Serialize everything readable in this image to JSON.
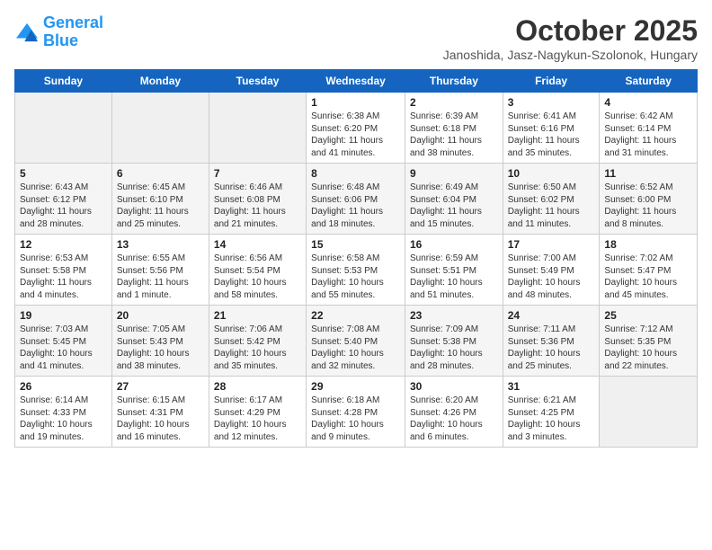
{
  "header": {
    "logo_line1": "General",
    "logo_line2": "Blue",
    "title": "October 2025",
    "subtitle": "Janoshida, Jasz-Nagykun-Szolonok, Hungary"
  },
  "days_of_week": [
    "Sunday",
    "Monday",
    "Tuesday",
    "Wednesday",
    "Thursday",
    "Friday",
    "Saturday"
  ],
  "weeks": [
    [
      {
        "num": "",
        "info": ""
      },
      {
        "num": "",
        "info": ""
      },
      {
        "num": "",
        "info": ""
      },
      {
        "num": "1",
        "info": "Sunrise: 6:38 AM\nSunset: 6:20 PM\nDaylight: 11 hours\nand 41 minutes."
      },
      {
        "num": "2",
        "info": "Sunrise: 6:39 AM\nSunset: 6:18 PM\nDaylight: 11 hours\nand 38 minutes."
      },
      {
        "num": "3",
        "info": "Sunrise: 6:41 AM\nSunset: 6:16 PM\nDaylight: 11 hours\nand 35 minutes."
      },
      {
        "num": "4",
        "info": "Sunrise: 6:42 AM\nSunset: 6:14 PM\nDaylight: 11 hours\nand 31 minutes."
      }
    ],
    [
      {
        "num": "5",
        "info": "Sunrise: 6:43 AM\nSunset: 6:12 PM\nDaylight: 11 hours\nand 28 minutes."
      },
      {
        "num": "6",
        "info": "Sunrise: 6:45 AM\nSunset: 6:10 PM\nDaylight: 11 hours\nand 25 minutes."
      },
      {
        "num": "7",
        "info": "Sunrise: 6:46 AM\nSunset: 6:08 PM\nDaylight: 11 hours\nand 21 minutes."
      },
      {
        "num": "8",
        "info": "Sunrise: 6:48 AM\nSunset: 6:06 PM\nDaylight: 11 hours\nand 18 minutes."
      },
      {
        "num": "9",
        "info": "Sunrise: 6:49 AM\nSunset: 6:04 PM\nDaylight: 11 hours\nand 15 minutes."
      },
      {
        "num": "10",
        "info": "Sunrise: 6:50 AM\nSunset: 6:02 PM\nDaylight: 11 hours\nand 11 minutes."
      },
      {
        "num": "11",
        "info": "Sunrise: 6:52 AM\nSunset: 6:00 PM\nDaylight: 11 hours\nand 8 minutes."
      }
    ],
    [
      {
        "num": "12",
        "info": "Sunrise: 6:53 AM\nSunset: 5:58 PM\nDaylight: 11 hours\nand 4 minutes."
      },
      {
        "num": "13",
        "info": "Sunrise: 6:55 AM\nSunset: 5:56 PM\nDaylight: 11 hours\nand 1 minute."
      },
      {
        "num": "14",
        "info": "Sunrise: 6:56 AM\nSunset: 5:54 PM\nDaylight: 10 hours\nand 58 minutes."
      },
      {
        "num": "15",
        "info": "Sunrise: 6:58 AM\nSunset: 5:53 PM\nDaylight: 10 hours\nand 55 minutes."
      },
      {
        "num": "16",
        "info": "Sunrise: 6:59 AM\nSunset: 5:51 PM\nDaylight: 10 hours\nand 51 minutes."
      },
      {
        "num": "17",
        "info": "Sunrise: 7:00 AM\nSunset: 5:49 PM\nDaylight: 10 hours\nand 48 minutes."
      },
      {
        "num": "18",
        "info": "Sunrise: 7:02 AM\nSunset: 5:47 PM\nDaylight: 10 hours\nand 45 minutes."
      }
    ],
    [
      {
        "num": "19",
        "info": "Sunrise: 7:03 AM\nSunset: 5:45 PM\nDaylight: 10 hours\nand 41 minutes."
      },
      {
        "num": "20",
        "info": "Sunrise: 7:05 AM\nSunset: 5:43 PM\nDaylight: 10 hours\nand 38 minutes."
      },
      {
        "num": "21",
        "info": "Sunrise: 7:06 AM\nSunset: 5:42 PM\nDaylight: 10 hours\nand 35 minutes."
      },
      {
        "num": "22",
        "info": "Sunrise: 7:08 AM\nSunset: 5:40 PM\nDaylight: 10 hours\nand 32 minutes."
      },
      {
        "num": "23",
        "info": "Sunrise: 7:09 AM\nSunset: 5:38 PM\nDaylight: 10 hours\nand 28 minutes."
      },
      {
        "num": "24",
        "info": "Sunrise: 7:11 AM\nSunset: 5:36 PM\nDaylight: 10 hours\nand 25 minutes."
      },
      {
        "num": "25",
        "info": "Sunrise: 7:12 AM\nSunset: 5:35 PM\nDaylight: 10 hours\nand 22 minutes."
      }
    ],
    [
      {
        "num": "26",
        "info": "Sunrise: 6:14 AM\nSunset: 4:33 PM\nDaylight: 10 hours\nand 19 minutes."
      },
      {
        "num": "27",
        "info": "Sunrise: 6:15 AM\nSunset: 4:31 PM\nDaylight: 10 hours\nand 16 minutes."
      },
      {
        "num": "28",
        "info": "Sunrise: 6:17 AM\nSunset: 4:29 PM\nDaylight: 10 hours\nand 12 minutes."
      },
      {
        "num": "29",
        "info": "Sunrise: 6:18 AM\nSunset: 4:28 PM\nDaylight: 10 hours\nand 9 minutes."
      },
      {
        "num": "30",
        "info": "Sunrise: 6:20 AM\nSunset: 4:26 PM\nDaylight: 10 hours\nand 6 minutes."
      },
      {
        "num": "31",
        "info": "Sunrise: 6:21 AM\nSunset: 4:25 PM\nDaylight: 10 hours\nand 3 minutes."
      },
      {
        "num": "",
        "info": ""
      }
    ]
  ]
}
